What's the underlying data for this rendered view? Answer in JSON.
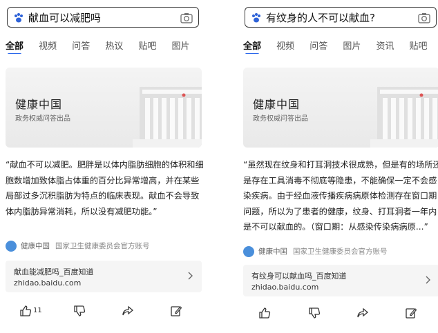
{
  "tabs": [
    "全部",
    "视频",
    "问答",
    "热议",
    "贴吧",
    "图片",
    "资讯",
    "贴吧"
  ],
  "left": {
    "query": "献血可以减肥吗",
    "tabs": [
      "全部",
      "视频",
      "问答",
      "热议",
      "贴吧",
      "图片"
    ],
    "card_title": "健康中国",
    "card_subtitle": "政务权威问答出品",
    "answer": "“献血不可以减肥。肥胖是以体内脂肪细胞的体积和细胞数增加致体脂占体重的百分比异常增高，并在某些局部过多沉积脂肪为特点的临床表现。献血不会导致体内脂肪异常消耗，所以没有减肥功能。”",
    "source_name": "健康中国",
    "source_desc": "国家卫生健康委员会官方账号",
    "link_title": "献血能减肥吗_百度知道",
    "link_url": "zhidao.baidu.com",
    "like_count": "11"
  },
  "right": {
    "query": "有纹身的人不可以献血?",
    "tabs": [
      "全部",
      "视频",
      "问答",
      "图片",
      "资讯",
      "贴吧"
    ],
    "card_title": "健康中国",
    "card_subtitle": "政务权威问答出品",
    "answer": "“虽然现在纹身和打耳洞技术很成熟，但是有的场所还是存在工具消毒不彻底等隐患，不能确保一定不会感染疾病。由于经血液传播疾病病原体检测存在窗口期问题，所以为了患者的健康，纹身、打耳洞者一年内是不可以献血的。（窗口期：从感染传染病病原...”",
    "source_name": "健康中国",
    "source_desc": "国家卫生健康委员会官方账号",
    "link_title": "有纹身可以献血吗_百度知道",
    "link_url": "zhidao.baidu.com"
  },
  "colors": {
    "accent": "#2563eb",
    "card_bg": "#eeeeee",
    "link_bg": "#f5f5f5"
  },
  "icons": [
    "paw-icon",
    "camera-icon",
    "chevron-right-icon",
    "thumbs-up-icon",
    "thumbs-down-icon",
    "share-icon",
    "edit-icon"
  ]
}
